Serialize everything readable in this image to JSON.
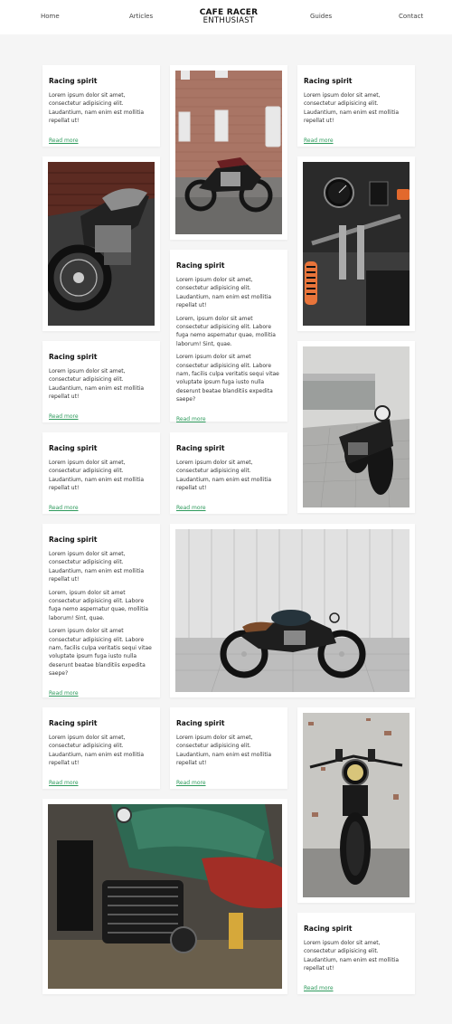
{
  "nav": {
    "home": "Home",
    "articles": "Articles",
    "logo_top": "CAFE RACER",
    "logo_bottom": "ENTHUSIAST",
    "guides": "Guides",
    "contact": "Contact"
  },
  "card": {
    "title": "Racing spirit",
    "p1": "Lorem ipsum dolor sit amet, consectetur adipisicing elit. Laudantium, nam enim est mollitia repellat ut!",
    "p2": "Lorem, ipsum dolor sit amet consectetur adipisicing elit. Labore fuga nemo aspernatur quae, mollitia laborum! Sint, quae.",
    "p3": "Lorem ipsum dolor sit amet consectetur adipisicing elit. Labore nam, facilis culpa veritatis sequi vitae voluptate ipsum fuga iusto nulla deserunt beatae blanditiis expedita saepe?",
    "read_more": "Read more"
  },
  "photos": {
    "photo1": "brick-building-motorcycle",
    "photo2": "motorcycle-brick-wall-closeup",
    "photo3": "handlebar-dashboard-closeup",
    "photo4": "black-motorcycle-front-view",
    "photo5": "motorcycle-side-view-garage",
    "photo6": "motorcycle-front-headlight",
    "photo7": "green-tank-engine-closeup"
  },
  "colors": {
    "accent": "#2e9a5c",
    "background": "#f5f5f5",
    "card": "#ffffff"
  }
}
